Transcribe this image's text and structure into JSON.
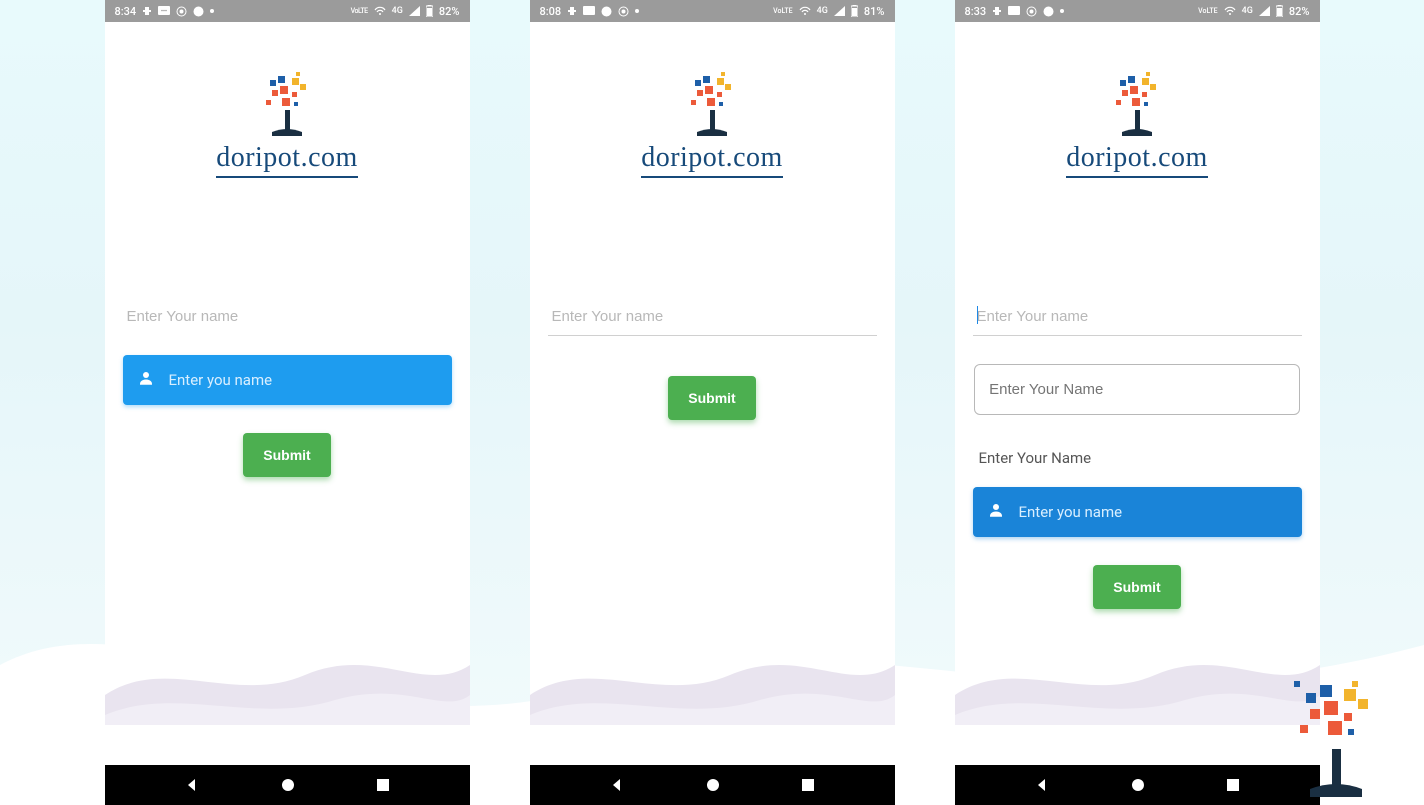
{
  "screens": [
    {
      "status": {
        "time": "8:34",
        "battery": "82%",
        "network": "4G"
      },
      "logo_text": "doripot.com",
      "underline_placeholder": "Enter Your name",
      "blue_placeholder": "Enter you name",
      "submit_label": "Submit"
    },
    {
      "status": {
        "time": "8:08",
        "battery": "81%",
        "network": "4G"
      },
      "logo_text": "doripot.com",
      "underline_placeholder": "Enter Your name",
      "submit_label": "Submit"
    },
    {
      "status": {
        "time": "8:33",
        "battery": "82%",
        "network": "4G"
      },
      "logo_text": "doripot.com",
      "underline_placeholder": "Enter Your name",
      "outlined_placeholder": "Enter Your Name",
      "plain_label": "Enter Your Name",
      "blue_placeholder": "Enter you name",
      "submit_label": "Submit"
    }
  ],
  "icons": {
    "lte": "LTE",
    "signal": "▲"
  }
}
